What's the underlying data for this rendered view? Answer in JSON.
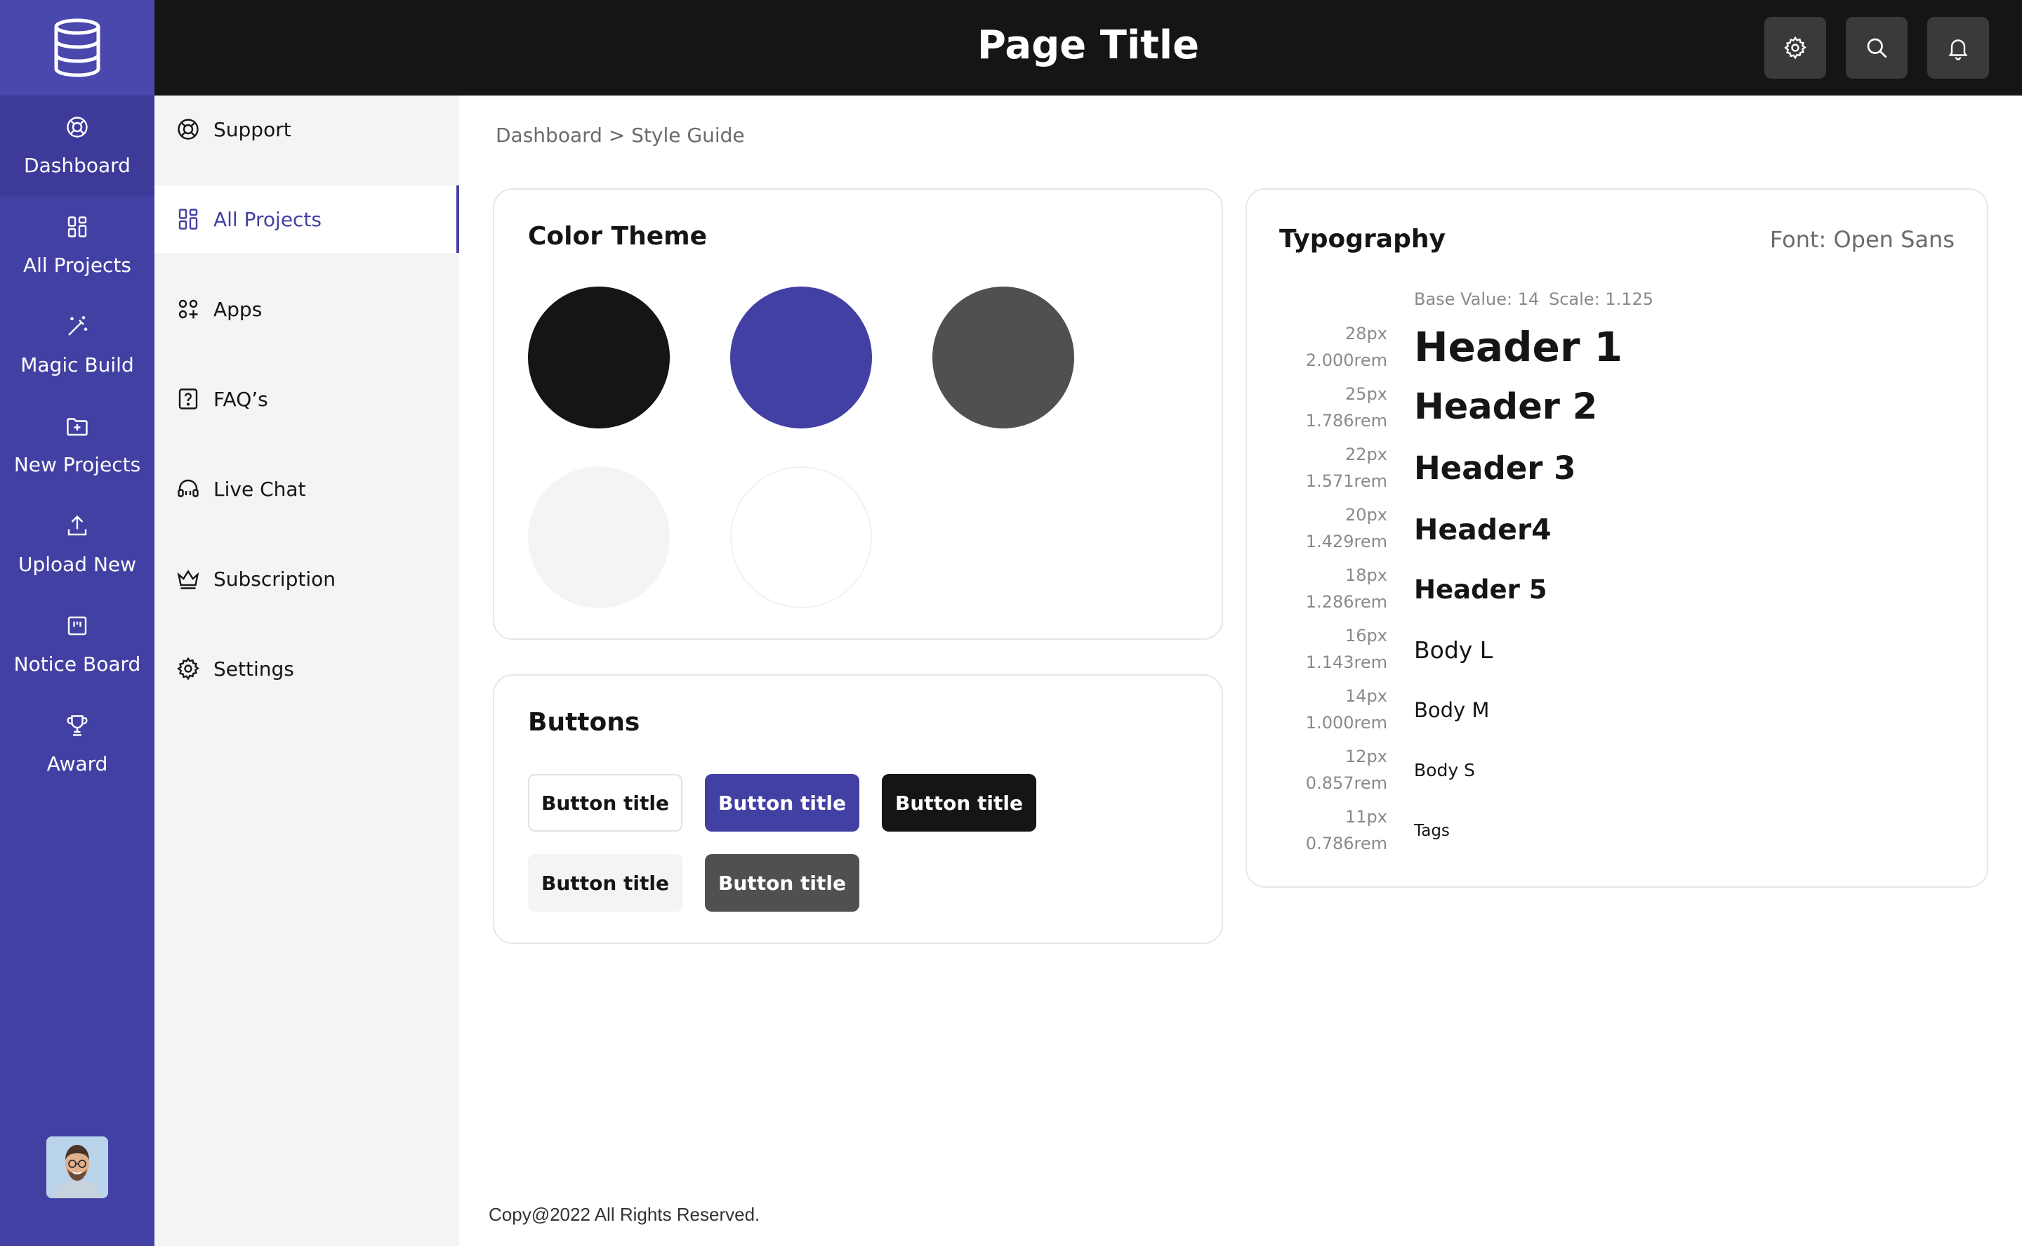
{
  "header": {
    "title": "Page Title"
  },
  "rail": {
    "items": [
      {
        "label": "Dashboard",
        "icon": "lifebuoy-icon"
      },
      {
        "label": "All Projects",
        "icon": "grid-icon"
      },
      {
        "label": "Magic Build",
        "icon": "magic-wand-icon"
      },
      {
        "label": "New Projects",
        "icon": "folder-plus-icon"
      },
      {
        "label": "Upload New",
        "icon": "upload-icon"
      },
      {
        "label": "Notice Board",
        "icon": "board-icon"
      },
      {
        "label": "Award",
        "icon": "trophy-icon"
      }
    ]
  },
  "subnav": {
    "items": [
      {
        "label": "Support",
        "icon": "lifebuoy-icon"
      },
      {
        "label": "All Projects",
        "icon": "grid-icon"
      },
      {
        "label": "Apps",
        "icon": "apps-icon"
      },
      {
        "label": "FAQ’s",
        "icon": "question-icon"
      },
      {
        "label": "Live Chat",
        "icon": "headset-icon"
      },
      {
        "label": "Subscription",
        "icon": "crown-icon"
      },
      {
        "label": "Settings",
        "icon": "gear-icon"
      }
    ],
    "active": "All Projects"
  },
  "breadcrumb": "Dashboard > Style Guide",
  "color_theme": {
    "title": "Color Theme",
    "colors": [
      "#151515",
      "#4340a4",
      "#4e514e",
      "#f4f4f7",
      "#ffffff"
    ]
  },
  "buttons": {
    "title": "Buttons",
    "items": [
      {
        "label": "Button title",
        "style": "outline"
      },
      {
        "label": "Button title",
        "style": "primary"
      },
      {
        "label": "Button title",
        "style": "dark"
      },
      {
        "label": "Button title",
        "style": "light"
      },
      {
        "label": "Button title",
        "style": "gray"
      }
    ]
  },
  "typography": {
    "title": "Typography",
    "font": "Font: Open Sans",
    "base": "Base Value: 14",
    "scale": "Scale: 1.125",
    "rows": [
      {
        "px": "28px",
        "rem": "2.000rem",
        "sample": "Header 1"
      },
      {
        "px": "25px",
        "rem": "1.786rem",
        "sample": "Header 2"
      },
      {
        "px": "22px",
        "rem": "1.571rem",
        "sample": "Header 3"
      },
      {
        "px": "20px",
        "rem": "1.429rem",
        "sample": "Header4"
      },
      {
        "px": "18px",
        "rem": "1.286rem",
        "sample": "Header 5"
      },
      {
        "px": "16px",
        "rem": "1.143rem",
        "sample": "Body L"
      },
      {
        "px": "14px",
        "rem": "1.000rem",
        "sample": "Body M"
      },
      {
        "px": "12px",
        "rem": "0.857rem",
        "sample": "Body S"
      },
      {
        "px": "11px",
        "rem": "0.786rem",
        "sample": "Tags"
      }
    ]
  },
  "footer": "Copy@2022 All Rights Reserved."
}
